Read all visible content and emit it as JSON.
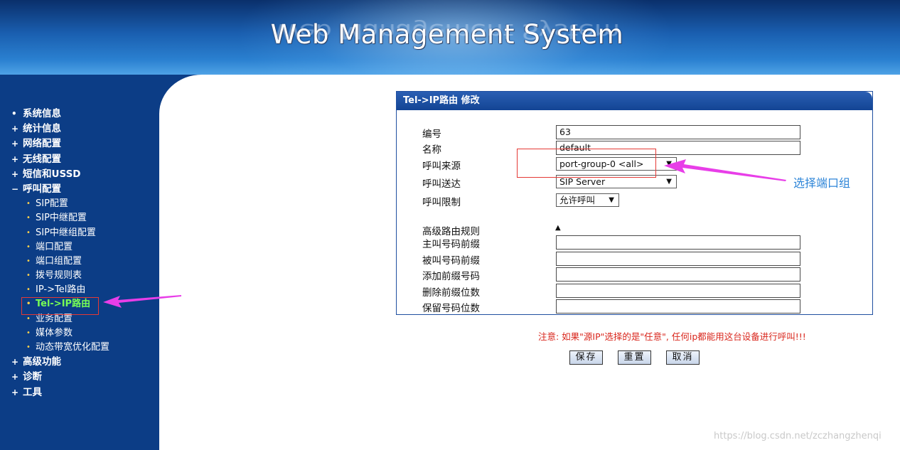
{
  "header": {
    "title": "Web Management System"
  },
  "sidebar": {
    "items": [
      {
        "mark": "•",
        "label": "系统信息"
      },
      {
        "mark": "+",
        "label": "统计信息"
      },
      {
        "mark": "+",
        "label": "网络配置"
      },
      {
        "mark": "+",
        "label": "无线配置"
      },
      {
        "mark": "+",
        "label": "短信和USSD"
      },
      {
        "mark": "−",
        "label": "呼叫配置"
      }
    ],
    "sub_items": [
      {
        "label": "SIP配置"
      },
      {
        "label": "SIP中继配置"
      },
      {
        "label": "SIP中继组配置"
      },
      {
        "label": "端口配置"
      },
      {
        "label": "端口组配置"
      },
      {
        "label": "拨号规则表"
      },
      {
        "label": "IP->Tel路由"
      },
      {
        "label": "Tel->IP路由",
        "active": true
      },
      {
        "label": "业务配置"
      },
      {
        "label": "媒体参数"
      },
      {
        "label": "动态带宽优化配置"
      }
    ],
    "items_after": [
      {
        "mark": "+",
        "label": "高级功能"
      },
      {
        "mark": "+",
        "label": "诊断"
      },
      {
        "mark": "+",
        "label": "工具"
      }
    ],
    "dot": "•"
  },
  "form": {
    "title": "Tel->IP路由 修改",
    "id_label": "编号",
    "id_value": "63",
    "name_label": "名称",
    "name_value": "default",
    "source_label": "呼叫来源",
    "source_value": "port-group-0 <all>",
    "dest_label": "呼叫送达",
    "dest_value": "SIP Server",
    "restrict_label": "呼叫限制",
    "restrict_value": "允许呼叫",
    "advanced_label": "高级路由规则",
    "advanced_toggle": "▲",
    "caller_prefix_label": "主叫号码前缀",
    "caller_prefix_value": "",
    "callee_prefix_label": "被叫号码前缀",
    "callee_prefix_value": "",
    "add_prefix_label": "添加前缀号码",
    "add_prefix_value": "",
    "delete_prefix_label": "删除前缀位数",
    "delete_prefix_value": "",
    "keep_digits_label": "保留号码位数",
    "keep_digits_value": "",
    "caret": "▼"
  },
  "notice": "注意: 如果\"源IP\"选择的是\"任意\", 任何ip都能用这台设备进行呼叫!!!",
  "buttons": {
    "save": "保存",
    "reset": "重置",
    "cancel": "取消"
  },
  "annotation": {
    "callout": "选择端口组",
    "arrow_color": "#e83ee8",
    "box_color": "#e53935"
  },
  "watermark": "https://blog.csdn.net/zczhangzhenqi"
}
